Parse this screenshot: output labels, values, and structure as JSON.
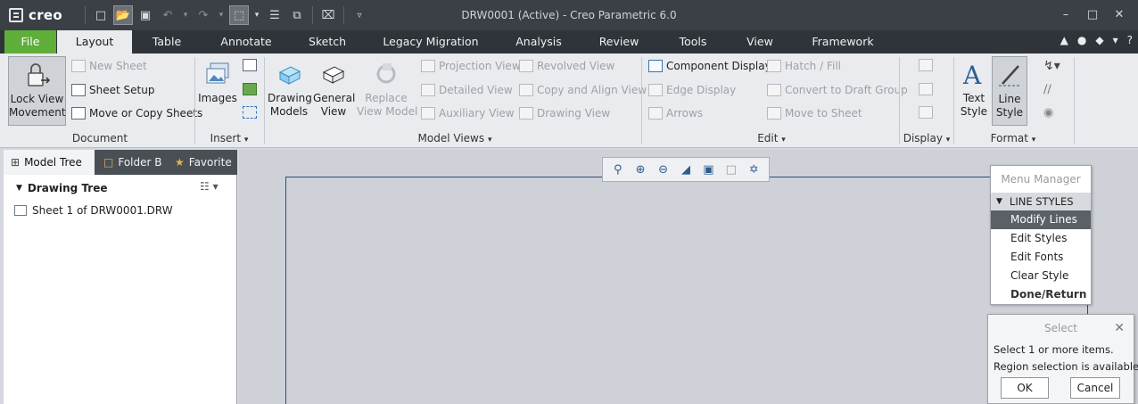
{
  "app": {
    "logo_text": "creo",
    "window_title": "DRW0001 (Active) - Creo Parametric 6.0"
  },
  "tabs": [
    {
      "label": "File"
    },
    {
      "label": "Layout"
    },
    {
      "label": "Table"
    },
    {
      "label": "Annotate"
    },
    {
      "label": "Sketch"
    },
    {
      "label": "Legacy Migration"
    },
    {
      "label": "Analysis"
    },
    {
      "label": "Review"
    },
    {
      "label": "Tools"
    },
    {
      "label": "View"
    },
    {
      "label": "Framework"
    }
  ],
  "ribbon": {
    "document": {
      "label": "Document",
      "lock_view": "Lock View\nMovement",
      "new_sheet": "New Sheet",
      "sheet_setup": "Sheet Setup",
      "move_copy": "Move or Copy Sheets"
    },
    "insert": {
      "label": "Insert",
      "images": "Images"
    },
    "model_views": {
      "label": "Model Views",
      "drawing_models": "Drawing\nModels",
      "general_view": "General\nView",
      "replace_view_model": "Replace\nView Model",
      "projection_view": "Projection View",
      "detailed_view": "Detailed View",
      "auxiliary_view": "Auxiliary View",
      "revolved_view": "Revolved View",
      "copy_align_view": "Copy and Align View",
      "drawing_view": "Drawing View"
    },
    "edit": {
      "label": "Edit",
      "component_display": "Component Display",
      "edge_display": "Edge Display",
      "arrows": "Arrows",
      "hatch_fill": "Hatch / Fill",
      "convert_draft": "Convert to Draft Group",
      "move_to_sheet": "Move to Sheet"
    },
    "display": {
      "label": "Display"
    },
    "format": {
      "label": "Format",
      "text_style": "Text\nStyle",
      "line_style": "Line\nStyle"
    }
  },
  "left_panel": {
    "tabs": [
      {
        "label": "Model Tree"
      },
      {
        "label": "Folder B"
      },
      {
        "label": "Favorite"
      }
    ],
    "tree_title": "Drawing Tree",
    "items": [
      {
        "label": "Sheet 1 of DRW0001.DRW"
      }
    ]
  },
  "menu_manager": {
    "title": "Menu Manager",
    "section": "LINE STYLES",
    "items": [
      {
        "label": "Modify Lines"
      },
      {
        "label": "Edit Styles"
      },
      {
        "label": "Edit Fonts"
      },
      {
        "label": "Clear Style"
      },
      {
        "label": "Done/Return"
      }
    ]
  },
  "select_dialog": {
    "title": "Select",
    "line1": "Select 1 or more items.",
    "line2": "Region selection is available.",
    "ok": "OK",
    "cancel": "Cancel"
  }
}
